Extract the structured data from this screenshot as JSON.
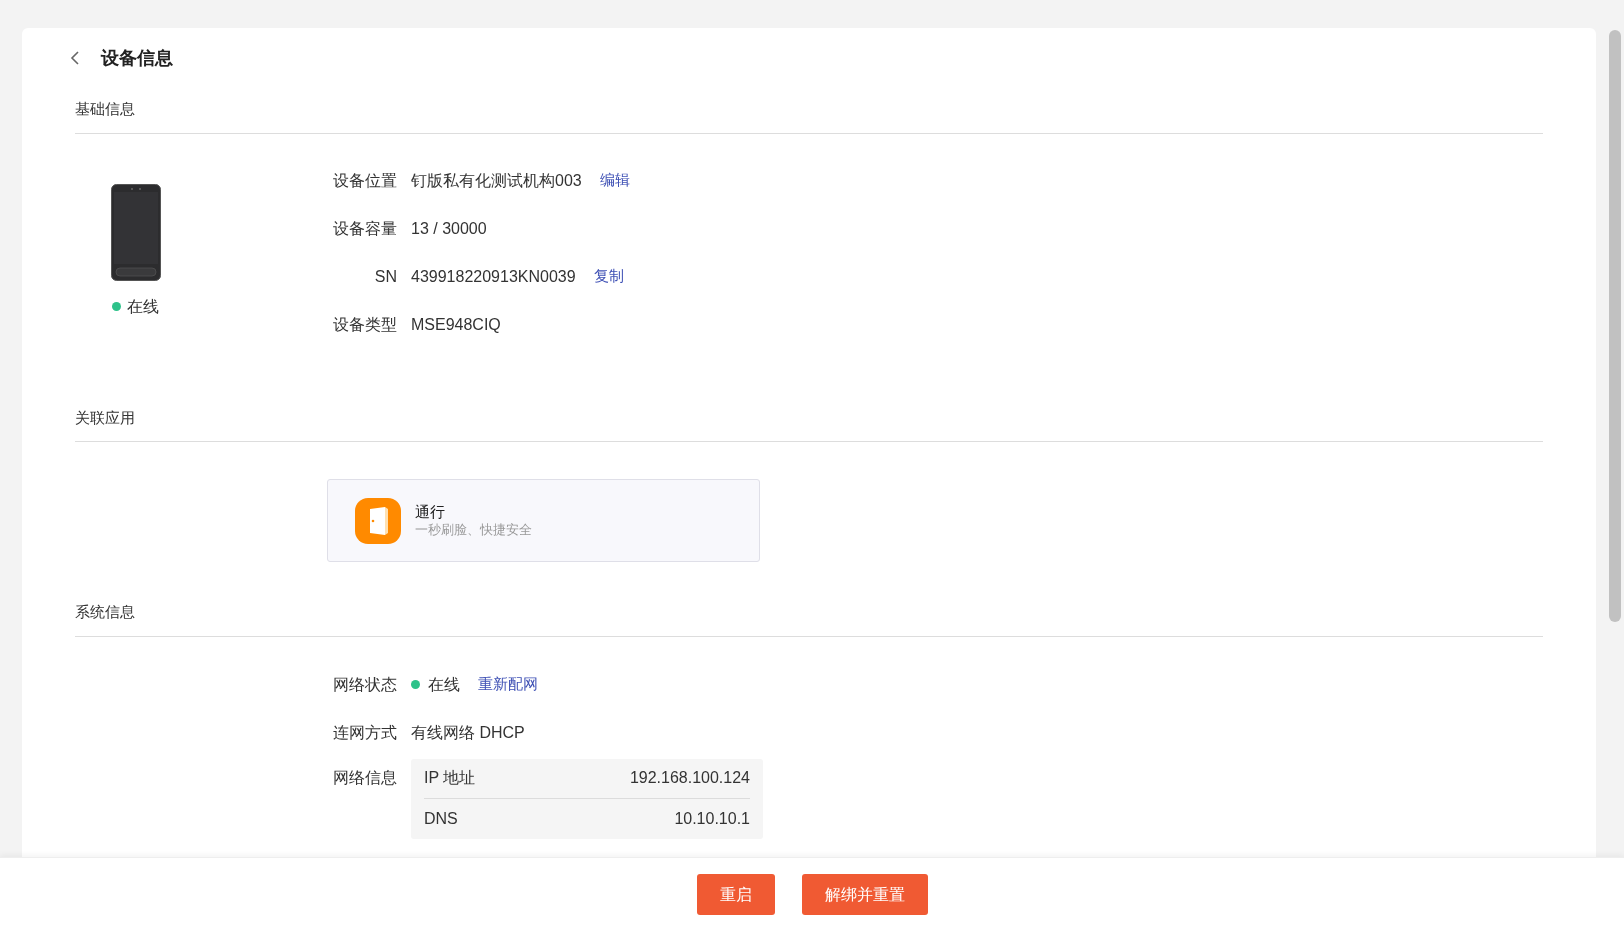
{
  "header": {
    "title": "设备信息"
  },
  "basic_info": {
    "title": "基础信息",
    "device_status": {
      "online": true,
      "label": "在线"
    },
    "fields": [
      {
        "label": "设备位置",
        "value": "钉版私有化测试机构003",
        "action": "编辑"
      },
      {
        "label": "设备容量",
        "value": "13 / 30000"
      },
      {
        "label": "SN",
        "value": "439918220913KN0039",
        "action": "复制"
      },
      {
        "label": "设备类型",
        "value": "MSE948CIQ"
      }
    ]
  },
  "linked_apps": {
    "title": "关联应用",
    "apps": [
      {
        "name": "通行",
        "description": "一秒刷脸、快捷安全"
      }
    ]
  },
  "system_info": {
    "title": "系统信息",
    "network_status": {
      "label": "网络状态",
      "online": true,
      "value": "在线",
      "action": "重新配网"
    },
    "connection": {
      "label": "连网方式",
      "value": "有线网络 DHCP"
    },
    "network_info": {
      "label": "网络信息",
      "rows": [
        {
          "name": "IP 地址",
          "value": "192.168.100.124"
        },
        {
          "name": "DNS",
          "value": "10.10.10.1"
        }
      ]
    }
  },
  "footer": {
    "buttons": [
      "重启",
      "解绑并重置"
    ]
  }
}
